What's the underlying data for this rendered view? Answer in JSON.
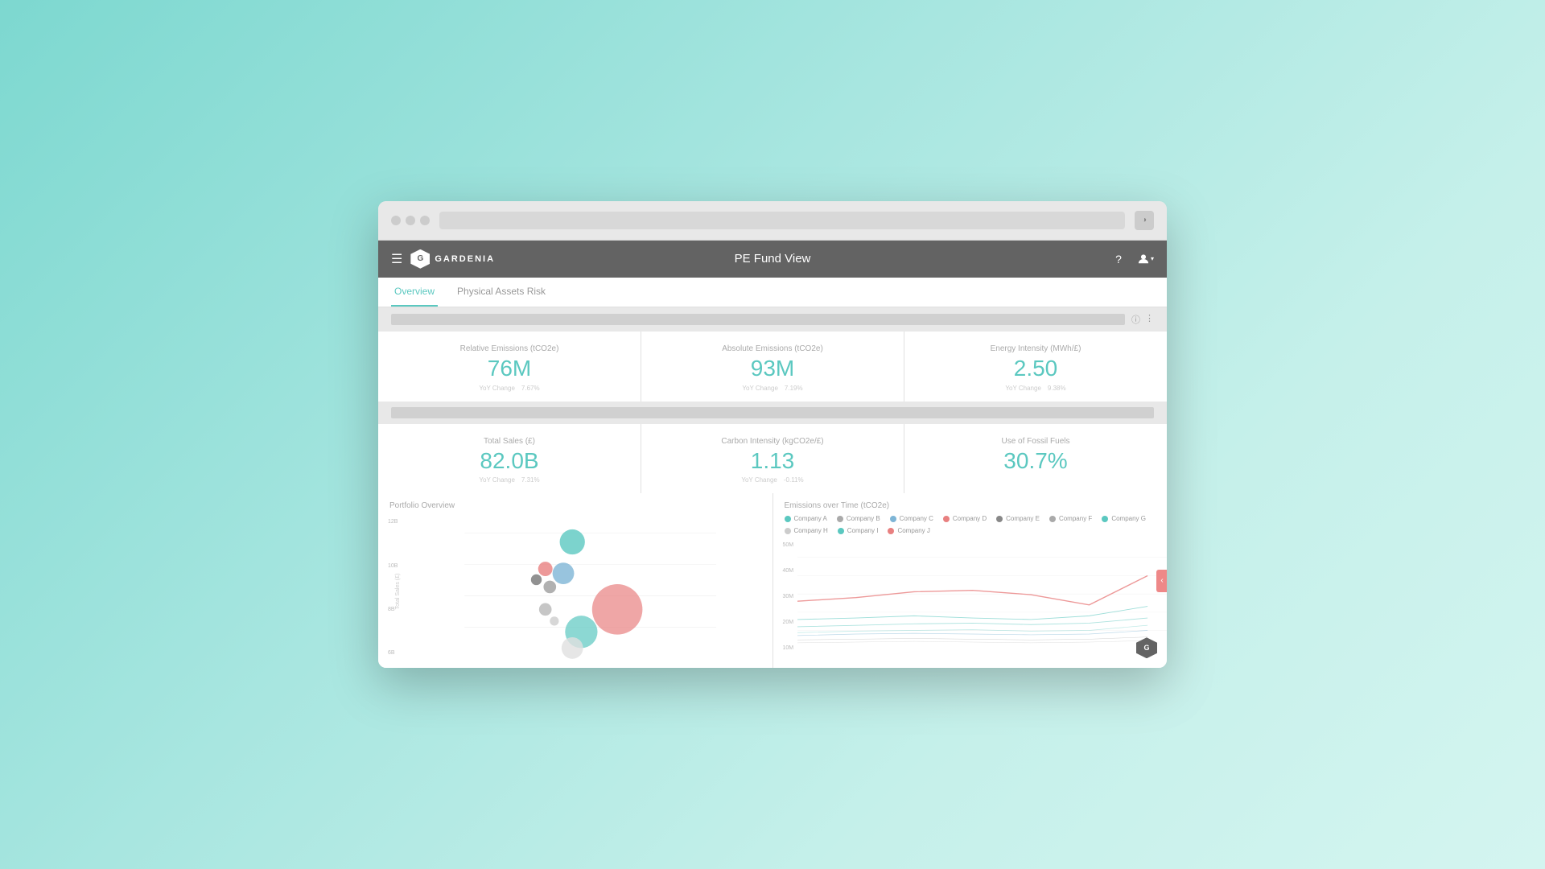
{
  "browser": {
    "url_placeholder": "",
    "theme_toggle": "◑"
  },
  "header": {
    "menu_icon": "☰",
    "logo_text": "GARDENIA",
    "title": "PE Fund View",
    "help_icon": "?",
    "user_icon": "👤"
  },
  "tabs": [
    {
      "label": "Overview",
      "active": true
    },
    {
      "label": "Physical Assets Risk",
      "active": false
    }
  ],
  "filter_bar": {
    "info_icon": "ⓘ",
    "more_icon": "⋮"
  },
  "stats": [
    {
      "label": "Relative Emissions (tCO2e)",
      "value": "76M",
      "change_label": "YoY Change",
      "change_value": "7.67%"
    },
    {
      "label": "Absolute Emissions (tCO2e)",
      "value": "93M",
      "change_label": "YoY Change",
      "change_value": "7.19%"
    },
    {
      "label": "Energy Intensity (MWh/£)",
      "value": "2.50",
      "change_label": "YoY Change",
      "change_value": "9.38%"
    },
    {
      "label": "Total Sales (£)",
      "value": "82.0B",
      "change_label": "YoY Change",
      "change_value": "7.31%"
    },
    {
      "label": "Carbon Intensity (kgCO2e/£)",
      "value": "1.13",
      "change_label": "YoY Change",
      "change_value": "-0.11%"
    },
    {
      "label": "Use of Fossil Fuels",
      "value": "30.7%",
      "change_label": "",
      "change_value": ""
    }
  ],
  "portfolio": {
    "title": "Portfolio Overview",
    "y_labels": [
      "12B",
      "10B",
      "8B",
      "6B"
    ],
    "y_axis_label": "Total Sales (£)"
  },
  "emissions": {
    "title": "Emissions over Time (tCO2e)",
    "y_labels": [
      "50M",
      "40M",
      "30M",
      "20M",
      "10M"
    ],
    "legend": [
      {
        "company": "Company A",
        "color": "#5bc8c0"
      },
      {
        "company": "Company B",
        "color": "#aaa"
      },
      {
        "company": "Company C",
        "color": "#7eb5d6"
      },
      {
        "company": "Company D",
        "color": "#e88080"
      },
      {
        "company": "Company E",
        "color": "#888"
      },
      {
        "company": "Company F",
        "color": "#aaa"
      },
      {
        "company": "Company G",
        "color": "#5bc8c0"
      },
      {
        "company": "Company H",
        "color": "#ccc"
      },
      {
        "company": "Company I",
        "color": "#5bc8c0"
      },
      {
        "company": "Company J",
        "color": "#e88080"
      }
    ]
  }
}
